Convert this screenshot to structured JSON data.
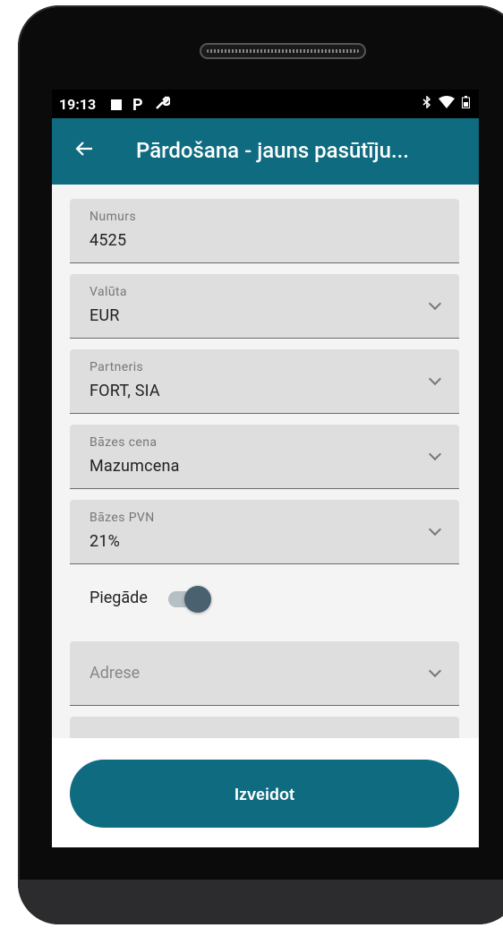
{
  "status_bar": {
    "time": "19:13",
    "left_icons": [
      "square-icon",
      "parking-icon",
      "wrench-icon"
    ],
    "right_icons": [
      "bluetooth-icon",
      "wifi-icon",
      "battery-icon"
    ]
  },
  "app_bar": {
    "title": "Pārdošana - jauns pasūtīju...",
    "back_icon": "back-arrow-icon",
    "color": "#0f6b7f"
  },
  "form": {
    "number": {
      "label": "Numurs",
      "value": "4525"
    },
    "currency": {
      "label": "Valūta",
      "value": "EUR"
    },
    "partner": {
      "label": "Partneris",
      "value": "FORT, SIA"
    },
    "base_price": {
      "label": "Bāzes cena",
      "value": "Mazumcena"
    },
    "base_vat": {
      "label": "Bāzes PVN",
      "value": "21%"
    },
    "delivery": {
      "label": "Piegāde",
      "enabled": true
    },
    "address": {
      "placeholder": "Adrese"
    }
  },
  "actions": {
    "create_label": "Izveidot"
  }
}
